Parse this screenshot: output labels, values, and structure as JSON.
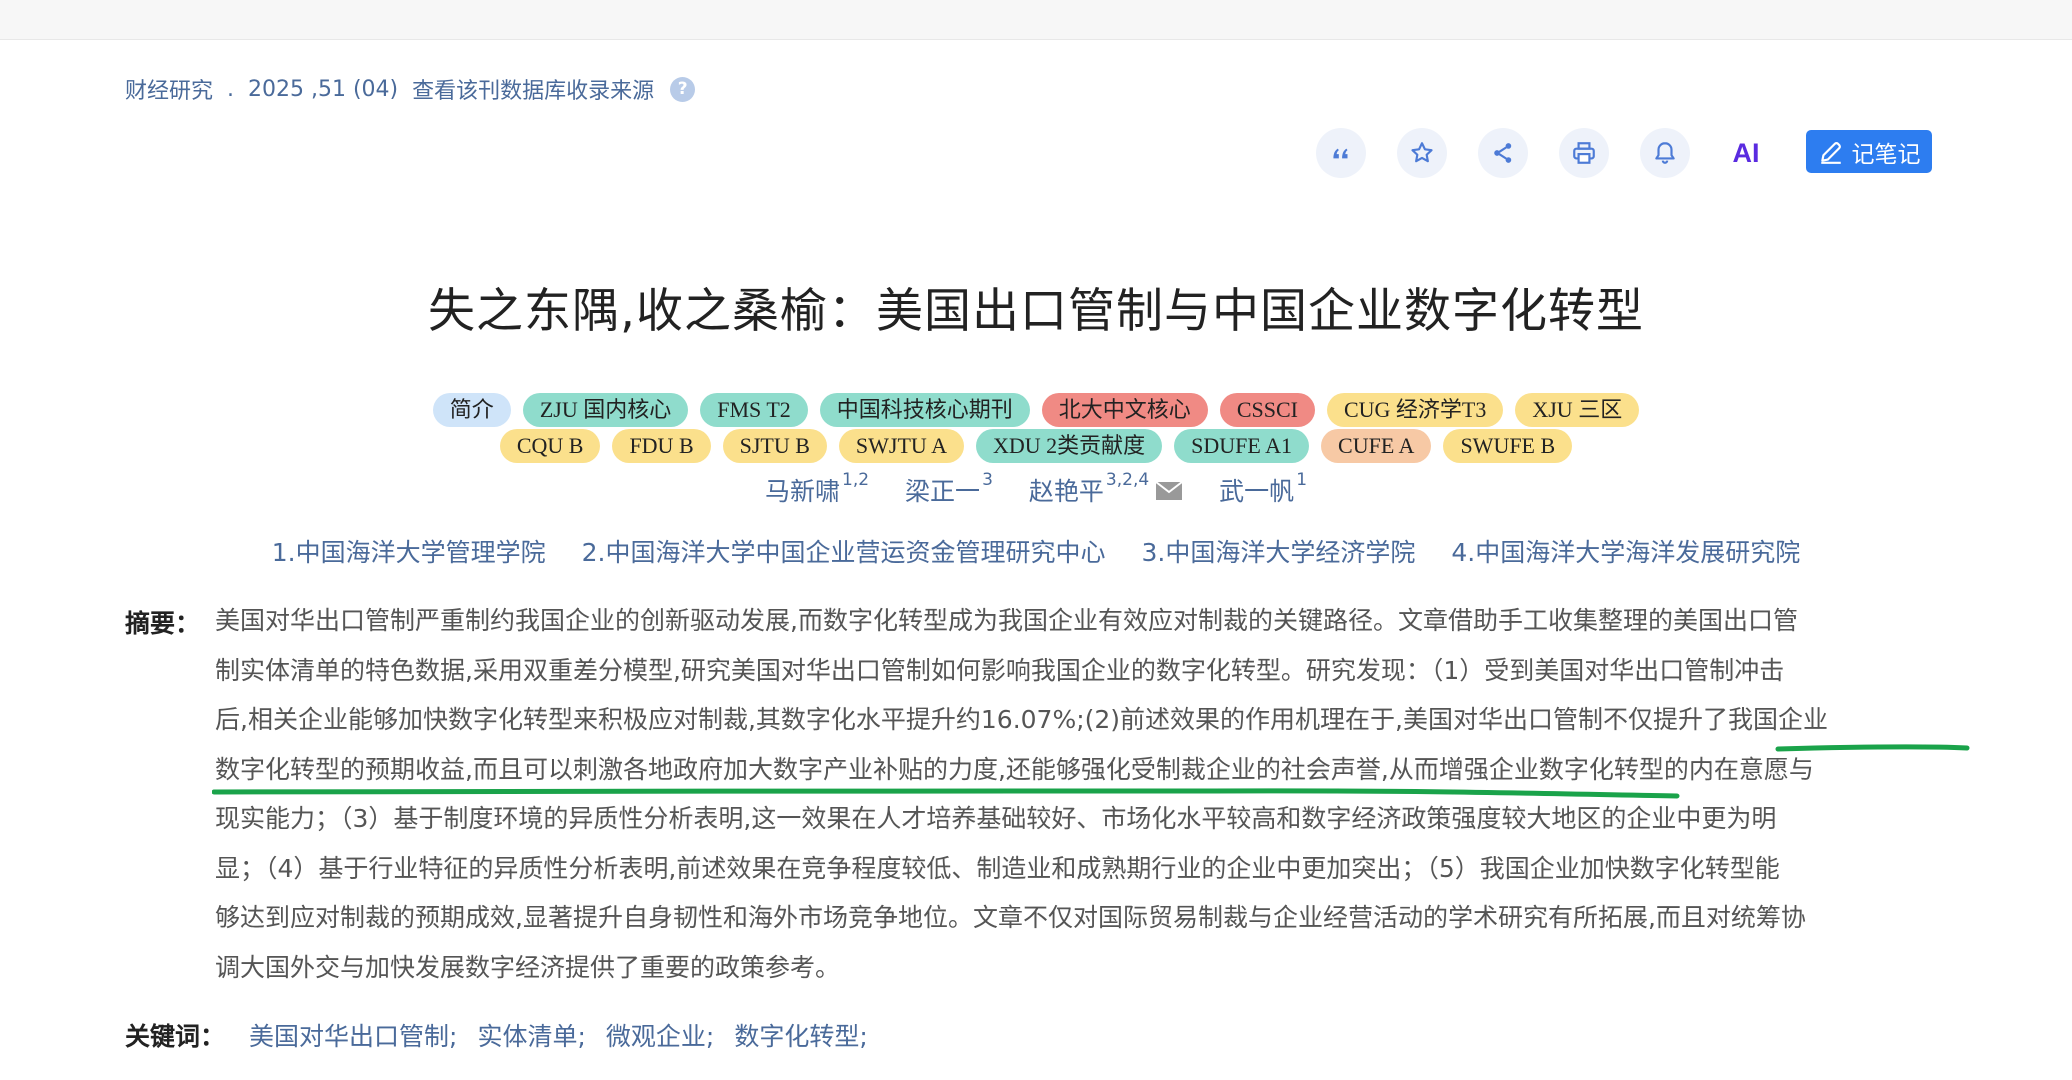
{
  "source": {
    "journal": "财经研究",
    "issue": "2025 ,51 (04)",
    "db_link": "查看该刊数据库收录来源",
    "help": "?"
  },
  "toolbar": {
    "ai_label": "AI",
    "note_label": "记笔记"
  },
  "title": "失之东隅,收之桑榆：美国出口管制与中国企业数字化转型",
  "tags_row1": [
    {
      "label": "简介",
      "color": "#cfe4f9"
    },
    {
      "label": "ZJU 国内核心",
      "color": "#8fdccc"
    },
    {
      "label": "FMS T2",
      "color": "#8fdccc"
    },
    {
      "label": "中国科技核心期刊",
      "color": "#8fdccc"
    },
    {
      "label": "北大中文核心",
      "color": "#f08a84"
    },
    {
      "label": "CSSCI",
      "color": "#f08a84"
    },
    {
      "label": "CUG 经济学T3",
      "color": "#fbe08c"
    },
    {
      "label": "XJU 三区",
      "color": "#fbe08c"
    }
  ],
  "tags_row2": [
    {
      "label": "CQU B",
      "color": "#fbe08c"
    },
    {
      "label": "FDU B",
      "color": "#fbe08c"
    },
    {
      "label": "SJTU B",
      "color": "#fbe08c"
    },
    {
      "label": "SWJTU A",
      "color": "#fbe08c"
    },
    {
      "label": "XDU 2类贡献度",
      "color": "#8fdccc"
    },
    {
      "label": "SDUFE A1",
      "color": "#8fdccc"
    },
    {
      "label": "CUFE A",
      "color": "#f7c9a5"
    },
    {
      "label": "SWUFE B",
      "color": "#fbe08c"
    }
  ],
  "authors": [
    {
      "name": "马新啸",
      "sup": "1,2"
    },
    {
      "name": "梁正一",
      "sup": "3"
    },
    {
      "name": "赵艳平",
      "sup": "3,2,4"
    },
    {
      "name": "武一帆",
      "sup": "1"
    }
  ],
  "affiliations": [
    "1.中国海洋大学管理学院",
    "2.中国海洋大学中国企业营运资金管理研究中心",
    "3.中国海洋大学经济学院",
    "4.中国海洋大学海洋发展研究院"
  ],
  "abstract": {
    "label": "摘要：",
    "lines": [
      "美国对华出口管制严重制约我国企业的创新驱动发展,而数字化转型成为我国企业有效应对制裁的关键路径。文章借助手工收集整理的美国出口管",
      "制实体清单的特色数据,采用双重差分模型,研究美国对华出口管制如何影响我国企业的数字化转型。研究发现：（1）受到美国对华出口管制冲击",
      "后,相关企业能够加快数字化转型来积极应对制裁,其数字化水平提升约16.07%;(2)前述效果的作用机理在于,美国对华出口管制不仅提升了我国企业",
      "数字化转型的预期收益,而且可以刺激各地政府加大数字产业补贴的力度,还能够强化受制裁企业的社会声誉,从而增强企业数字化转型的内在意愿与",
      "现实能力；（3）基于制度环境的异质性分析表明,这一效果在人才培养基础较好、市场化水平较高和数字经济政策强度较大地区的企业中更为明",
      "显；（4）基于行业特征的异质性分析表明,前述效果在竞争程度较低、制造业和成熟期行业的企业中更加突出；（5）我国企业加快数字化转型能",
      "够达到应对制裁的预期成效,显著提升自身韧性和海外市场竞争地位。文章不仅对国际贸易制裁与企业经营活动的学术研究有所拓展,而且对统筹协",
      "调大国外交与加快发展数字经济提供了重要的政策参考。"
    ]
  },
  "keywords": {
    "label": "关键词：",
    "items": [
      "美国对华出口管制;",
      "实体清单;",
      "微观企业;",
      "数字化转型;"
    ]
  },
  "colors": {
    "link": "#4a6a9a",
    "accent": "#2d7df0",
    "highlight_stroke": "#1aa34a"
  }
}
